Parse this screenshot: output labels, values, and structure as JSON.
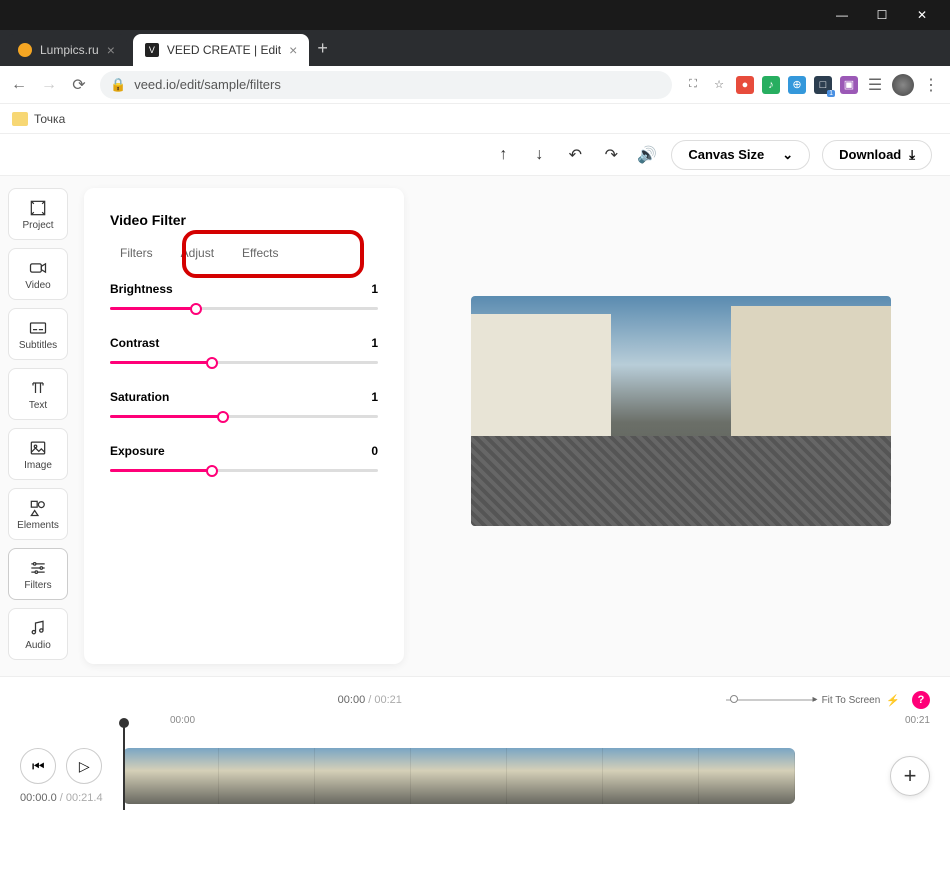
{
  "titlebar": {
    "min": "—",
    "max": "☐",
    "close": "✕"
  },
  "tabs": {
    "inactive": {
      "label": "Lumpics.ru",
      "favicon_color": "#f5a623"
    },
    "active": {
      "label": "VEED CREATE | Edit",
      "favicon_letter": "V"
    },
    "close": "×",
    "new": "+"
  },
  "addr": {
    "back": "←",
    "fwd": "→",
    "reload": "⟳",
    "lock": "🔒",
    "url": "veed.io/edit/sample/filters",
    "more": "⋮"
  },
  "bookmarks": {
    "item1": "Точка"
  },
  "toolbar": {
    "up": "↑",
    "down": "↓",
    "undo": "↶",
    "redo": "↷",
    "volume": "🔊",
    "canvas": "Canvas Size",
    "chev": "⌄",
    "download": "Download",
    "dlicon": "⤓"
  },
  "nav": {
    "project": "Project",
    "video": "Video",
    "subtitles": "Subtitles",
    "text": "Text",
    "image": "Image",
    "elements": "Elements",
    "filters": "Filters",
    "audio": "Audio"
  },
  "panel": {
    "title": "Video Filter",
    "tab_filters": "Filters",
    "tab_adjust": "Adjust",
    "tab_effects": "Effects",
    "sliders": {
      "brightness": {
        "label": "Brightness",
        "value": "1",
        "pct": 32
      },
      "contrast": {
        "label": "Contrast",
        "value": "1",
        "pct": 38
      },
      "saturation": {
        "label": "Saturation",
        "value": "1",
        "pct": 42
      },
      "exposure": {
        "label": "Exposure",
        "value": "0",
        "pct": 38
      }
    }
  },
  "bottom": {
    "center_time": "00:00",
    "center_dur": "/ 00:21",
    "fit": "Fit To Screen",
    "bolt": "⚡",
    "help": "?",
    "tl_start": "00:00",
    "tl_end": "00:21",
    "skip": "⏮",
    "play": "▷",
    "cur": "00:00.0",
    "dur": "/ 00:21.4",
    "add": "+"
  }
}
